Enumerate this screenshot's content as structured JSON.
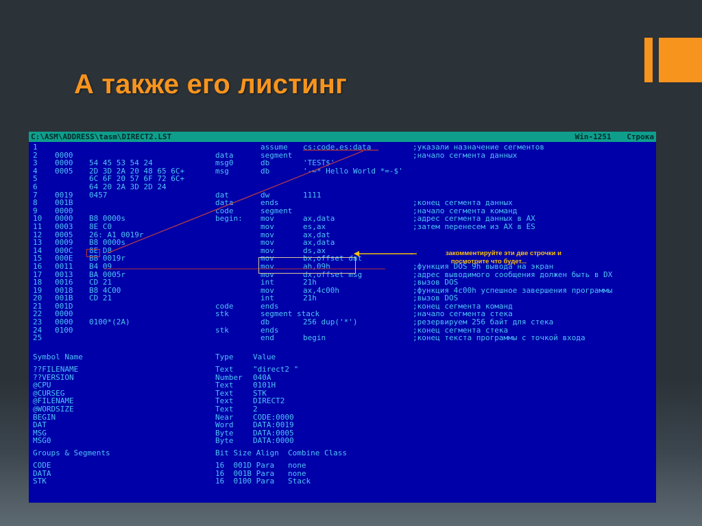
{
  "slide": {
    "title": "А также его листинг",
    "title_color": "#f7941e",
    "background_color": "#2b3238",
    "decoration": {
      "accent_color": "#f7941e"
    }
  },
  "editor": {
    "titlebar": {
      "path": "C:\\ASM\\ADDRESS\\tasm\\DIRECT2.LST",
      "encoding": "Win-1251",
      "status": "Строка"
    },
    "background_color": "#0000a8",
    "text_color": "#4fc3f7",
    "columns": {
      "line": "1\n2\n3\n4\n5\n6\n7\n8\n9\n10\n11\n12\n13\n14\n15\n16\n17\n18\n19\n20\n21\n22\n23\n24\n25",
      "address": "\n0000\n0000\n0005\n\n\n0019\n001B\n0000\n0000\n0003\n0005\n0009\n000C\n000E\n0011\n0013\n0016\n0018\n001B\n001D\n0000\n0000\n0100\n",
      "bytes": "\n\n54 45 53 54 24\n2D 3D 2A 20 48 65 6C+\n6C 6F 20 57 6F 72 6C+\n64 20 2A 3D 2D 24\n0457\n\n\nB8 0000s\n8E C0\n26: A1 0019r\nB8 0000s\n8E D8\nBB 0019r\nB4 09\nBA 0005r\nCD 21\nB8 4C00\nCD 21\n\n\n0100*(2A)\n\n",
      "label": "\ndata\nmsg0\nmsg\n\n\ndat\ndata\ncode\nbegin:\n\n\n\n\n\n\n\n\n\n\ncode\nstk\n\nstk\n",
      "op": "assume\nsegment\ndb\ndb\n\n\ndw\nends\nsegment\nmov\nmov\nmov\nmov\nmov\nmov\nmov\nmov\nint\nmov\nint\nends\nsegment stack\ndb\nends\nend",
      "arg": "cs:code,es:data\n\n'TEST$'\n'-=* Hello World *=-$'\n\n\n1111\n\n\nax,data\nes,ax\nax,dat\nax,data\nds,ax\nbx,offset dat\nah,09h\ndx,offset msg\n21h\nax,4c00h\n21h\n\n\n256 dup('*')\n\nbegin",
      "comment": ";указали назначение сегментов\n;начало сегмента данных\n\n\n\n\n\n;конец сегмента данных\n;начало сегмента команд\n;адрес сегмента данных в AX\n;затем перенесем из AX в ES\n\n\n\n\n;функция DOS 9h вывода на экран\n;адрес выводимого сообщения должен быть в DX\n;вызов DOS\n;функция 4c00h успешное завершения программы\n;вызов DOS\n;конец сегмента команд\n;начало сегмента стека\n;резервируем 256 байт для стека\n;конец сегмента стека\n;конец текста программы с точкой входа"
    },
    "symbol_table": {
      "header_name": "Symbol Name",
      "header_type": "Type",
      "header_value": "Value",
      "names": "??FILENAME\n??VERSION\n@CPU\n@CURSEG\n@FILENAME\n@WORDSIZE\nBEGIN\nDAT\nMSG\nMSG0",
      "types": "Text\nNumber\nText\nText\nText\nText\nNear\nWord\nByte\nByte",
      "values": "\"direct2 \"\n040A\n0101H\nSTK\nDIRECT2\n2\nCODE:0000\nDATA:0019\nDATA:0005\nDATA:0000"
    },
    "groups_table": {
      "header_name": "Groups & Segments",
      "header_cols": "Bit Size Align  Combine Class",
      "names": "CODE\nDATA\nSTK",
      "rows": "16  001D Para   none\n16  001B Para   none\n16  0100 Para   Stack"
    },
    "annotation": {
      "text": "закомментируйте эти две строчки и\n   посмотрите что будет...",
      "text_color": "#f9c10a",
      "highlight_box_color": "#d9c89a",
      "marker_box_color": "#c0392b"
    }
  }
}
